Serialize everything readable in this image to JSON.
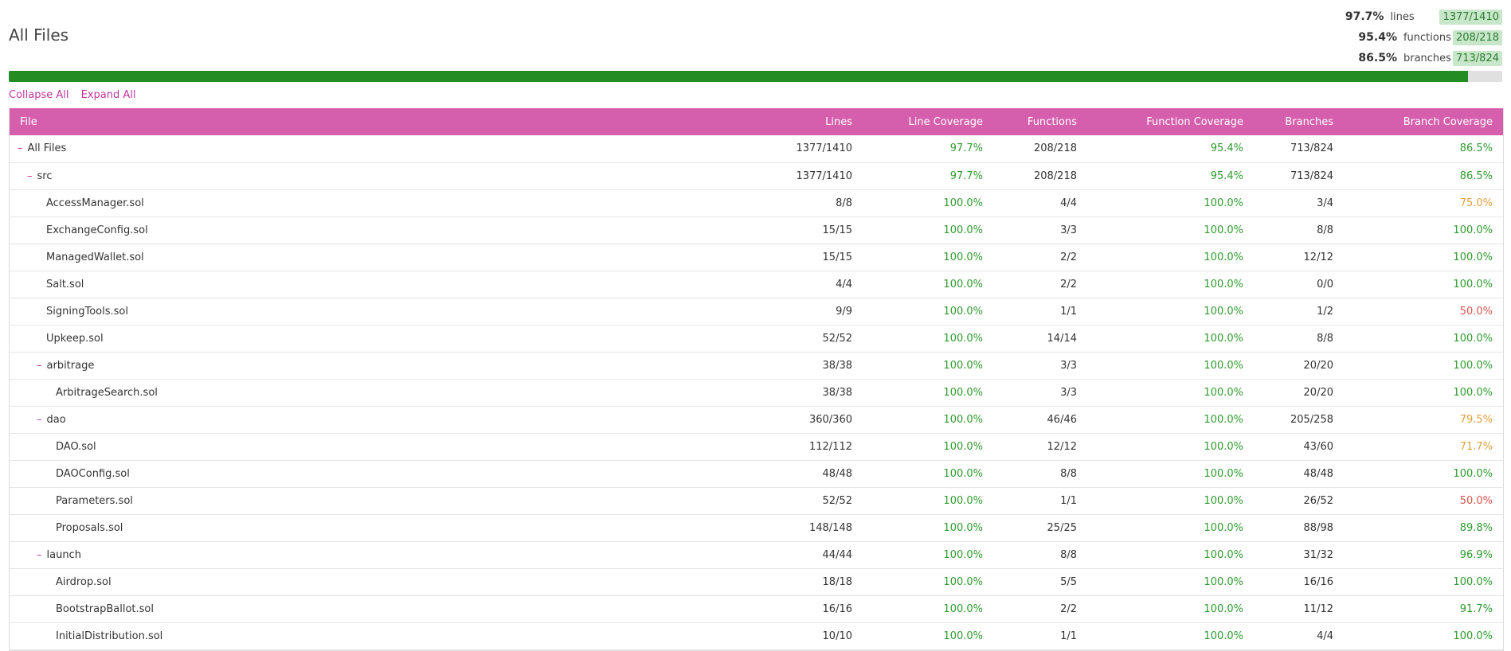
{
  "title": "All Files",
  "summary": [
    {
      "pct": "97.7%",
      "label": "lines",
      "badge": "1377/1410"
    },
    {
      "pct": "95.4%",
      "label": "functions",
      "badge": "208/218"
    },
    {
      "pct": "86.5%",
      "label": "branches",
      "badge": "713/824"
    }
  ],
  "progress": {
    "value": 0.977,
    "color": "#238c23"
  },
  "controls": {
    "collapse_all": "Collapse All",
    "expand_all": "Expand All"
  },
  "headers": {
    "file": "File",
    "lines": "Lines",
    "line_coverage": "Line Coverage",
    "functions": "Functions",
    "function_coverage": "Function Coverage",
    "branches": "Branches",
    "branch_coverage": "Branch Coverage"
  },
  "colors": {
    "accent": "#d55fad",
    "link": "#c2359b",
    "good": "#2e9b2e",
    "medium": "#e09f3e",
    "low": "#d9534f"
  },
  "rows": [
    {
      "name": "All Files",
      "depth": 0,
      "toggle": "–",
      "lines": "1377/1410",
      "line_cov": "97.7%",
      "functions": "208/218",
      "func_cov": "95.4%",
      "branches": "713/824",
      "branch_cov": "86.5%",
      "branch_level": "good"
    },
    {
      "name": "src",
      "depth": 1,
      "toggle": "–",
      "lines": "1377/1410",
      "line_cov": "97.7%",
      "functions": "208/218",
      "func_cov": "95.4%",
      "branches": "713/824",
      "branch_cov": "86.5%",
      "branch_level": "good"
    },
    {
      "name": "AccessManager.sol",
      "depth": 2,
      "toggle": "",
      "lines": "8/8",
      "line_cov": "100.0%",
      "functions": "4/4",
      "func_cov": "100.0%",
      "branches": "3/4",
      "branch_cov": "75.0%",
      "branch_level": "medium"
    },
    {
      "name": "ExchangeConfig.sol",
      "depth": 2,
      "toggle": "",
      "lines": "15/15",
      "line_cov": "100.0%",
      "functions": "3/3",
      "func_cov": "100.0%",
      "branches": "8/8",
      "branch_cov": "100.0%",
      "branch_level": "good"
    },
    {
      "name": "ManagedWallet.sol",
      "depth": 2,
      "toggle": "",
      "lines": "15/15",
      "line_cov": "100.0%",
      "functions": "2/2",
      "func_cov": "100.0%",
      "branches": "12/12",
      "branch_cov": "100.0%",
      "branch_level": "good"
    },
    {
      "name": "Salt.sol",
      "depth": 2,
      "toggle": "",
      "lines": "4/4",
      "line_cov": "100.0%",
      "functions": "2/2",
      "func_cov": "100.0%",
      "branches": "0/0",
      "branch_cov": "100.0%",
      "branch_level": "good"
    },
    {
      "name": "SigningTools.sol",
      "depth": 2,
      "toggle": "",
      "lines": "9/9",
      "line_cov": "100.0%",
      "functions": "1/1",
      "func_cov": "100.0%",
      "branches": "1/2",
      "branch_cov": "50.0%",
      "branch_level": "low"
    },
    {
      "name": "Upkeep.sol",
      "depth": 2,
      "toggle": "",
      "lines": "52/52",
      "line_cov": "100.0%",
      "functions": "14/14",
      "func_cov": "100.0%",
      "branches": "8/8",
      "branch_cov": "100.0%",
      "branch_level": "good"
    },
    {
      "name": "arbitrage",
      "depth": 2,
      "toggle": "–",
      "lines": "38/38",
      "line_cov": "100.0%",
      "functions": "3/3",
      "func_cov": "100.0%",
      "branches": "20/20",
      "branch_cov": "100.0%",
      "branch_level": "good"
    },
    {
      "name": "ArbitrageSearch.sol",
      "depth": 3,
      "toggle": "",
      "lines": "38/38",
      "line_cov": "100.0%",
      "functions": "3/3",
      "func_cov": "100.0%",
      "branches": "20/20",
      "branch_cov": "100.0%",
      "branch_level": "good"
    },
    {
      "name": "dao",
      "depth": 2,
      "toggle": "–",
      "lines": "360/360",
      "line_cov": "100.0%",
      "functions": "46/46",
      "func_cov": "100.0%",
      "branches": "205/258",
      "branch_cov": "79.5%",
      "branch_level": "medium"
    },
    {
      "name": "DAO.sol",
      "depth": 3,
      "toggle": "",
      "lines": "112/112",
      "line_cov": "100.0%",
      "functions": "12/12",
      "func_cov": "100.0%",
      "branches": "43/60",
      "branch_cov": "71.7%",
      "branch_level": "medium"
    },
    {
      "name": "DAOConfig.sol",
      "depth": 3,
      "toggle": "",
      "lines": "48/48",
      "line_cov": "100.0%",
      "functions": "8/8",
      "func_cov": "100.0%",
      "branches": "48/48",
      "branch_cov": "100.0%",
      "branch_level": "good"
    },
    {
      "name": "Parameters.sol",
      "depth": 3,
      "toggle": "",
      "lines": "52/52",
      "line_cov": "100.0%",
      "functions": "1/1",
      "func_cov": "100.0%",
      "branches": "26/52",
      "branch_cov": "50.0%",
      "branch_level": "low"
    },
    {
      "name": "Proposals.sol",
      "depth": 3,
      "toggle": "",
      "lines": "148/148",
      "line_cov": "100.0%",
      "functions": "25/25",
      "func_cov": "100.0%",
      "branches": "88/98",
      "branch_cov": "89.8%",
      "branch_level": "good"
    },
    {
      "name": "launch",
      "depth": 2,
      "toggle": "–",
      "lines": "44/44",
      "line_cov": "100.0%",
      "functions": "8/8",
      "func_cov": "100.0%",
      "branches": "31/32",
      "branch_cov": "96.9%",
      "branch_level": "good"
    },
    {
      "name": "Airdrop.sol",
      "depth": 3,
      "toggle": "",
      "lines": "18/18",
      "line_cov": "100.0%",
      "functions": "5/5",
      "func_cov": "100.0%",
      "branches": "16/16",
      "branch_cov": "100.0%",
      "branch_level": "good"
    },
    {
      "name": "BootstrapBallot.sol",
      "depth": 3,
      "toggle": "",
      "lines": "16/16",
      "line_cov": "100.0%",
      "functions": "2/2",
      "func_cov": "100.0%",
      "branches": "11/12",
      "branch_cov": "91.7%",
      "branch_level": "good"
    },
    {
      "name": "InitialDistribution.sol",
      "depth": 3,
      "toggle": "",
      "lines": "10/10",
      "line_cov": "100.0%",
      "functions": "1/1",
      "func_cov": "100.0%",
      "branches": "4/4",
      "branch_cov": "100.0%",
      "branch_level": "good"
    }
  ]
}
